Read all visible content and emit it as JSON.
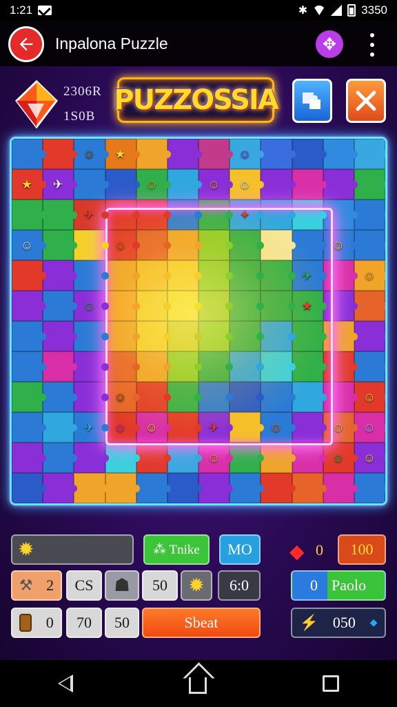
{
  "status_bar": {
    "time": "1:21",
    "battery_text": "3350",
    "icons": [
      "mail-icon",
      "bluetooth-icon",
      "wifi-icon",
      "signal-icon",
      "battery-icon"
    ]
  },
  "app_bar": {
    "title": "Inpalona Puzzle",
    "back_icon": "back-arrow-icon",
    "gamepad_icon": "gamepad-icon",
    "menu_icon": "more-vert-icon"
  },
  "game_header": {
    "stat_1": "2306R",
    "stat_2": "1S0B",
    "logo_text": "PUZZOSSIA",
    "blue_button_icon": "puzzle-piece-icon",
    "orange_button_icon": "close-icon"
  },
  "board": {
    "rows": 12,
    "cols": 12,
    "highlight_region": "center",
    "colors": [
      [
        "#2b7bd6",
        "#e23a2a",
        "#2b7bd6",
        "#e67a1a",
        "#f0a52a",
        "#8a2fd8",
        "#c23a8a",
        "#3aa8e0",
        "#3a6ee0",
        "#2b5bc8",
        "#2f8ae0",
        "#3aa8e0"
      ],
      [
        "#e23a2a",
        "#8a2fd8",
        "#2b7bd6",
        "#2b5bc8",
        "#2fb04a",
        "#2fa8e0",
        "#8a2fd8",
        "#f5c02a",
        "#8a2fd8",
        "#d82fa8",
        "#8a2fd8",
        "#2fb04a"
      ],
      [
        "#2fb04a",
        "#2fb04a",
        "#d83a2a",
        "#e23a2a",
        "#e23a2a",
        "#2b7bd6",
        "#2fb04a",
        "#2fa8e0",
        "#2fa8e0",
        "#3ad0e0",
        "#2f8ae0",
        "#2b7bd6"
      ],
      [
        "#2b7bd6",
        "#2fb04a",
        "#f5d02a",
        "#e23a2a",
        "#e6642a",
        "#f0a52a",
        "#8ad02a",
        "#2fb04a",
        "#f5e89a",
        "#2b7bd6",
        "#2b7bd6",
        "#2b7bd6"
      ],
      [
        "#e23a2a",
        "#8a2fd8",
        "#2b7bd6",
        "#f0a52a",
        "#f5c02a",
        "#f5d02a",
        "#8ad02a",
        "#2fb04a",
        "#2fb04a",
        "#2b7bd6",
        "#d82fa8",
        "#f0a52a"
      ],
      [
        "#8a2fd8",
        "#2b7bd6",
        "#8a2fd8",
        "#f5a52a",
        "#f5d02a",
        "#f5e02a",
        "#9ad02a",
        "#2fb04a",
        "#2fb04a",
        "#2fb04a",
        "#8a2fd8",
        "#e6642a"
      ],
      [
        "#2b7bd6",
        "#8a2fd8",
        "#2b7bd6",
        "#f0a52a",
        "#f5d02a",
        "#d0d02a",
        "#8ad02a",
        "#2fb04a",
        "#2fa8e0",
        "#2fb04a",
        "#f0a52a",
        "#8a2fd8"
      ],
      [
        "#2b7bd6",
        "#d82fa8",
        "#8a2fd8",
        "#e6642a",
        "#f0a52a",
        "#8ad02a",
        "#2fb04a",
        "#2fa8e0",
        "#3ad0e0",
        "#2fb04a",
        "#e23a2a",
        "#2b7bd6"
      ],
      [
        "#2fb04a",
        "#2b7bd6",
        "#8a2fd8",
        "#e6642a",
        "#e23a2a",
        "#2fb04a",
        "#2b7bd6",
        "#2b5bc8",
        "#2b7bd6",
        "#2fa8e0",
        "#d82fa8",
        "#e23a2a"
      ],
      [
        "#2b7bd6",
        "#2fa8e0",
        "#2b7bd6",
        "#e23a2a",
        "#d82fa8",
        "#e23a2a",
        "#8a2fd8",
        "#f5c02a",
        "#2b7bd6",
        "#8a2fd8",
        "#e6642a",
        "#d82fa8"
      ],
      [
        "#8a2fd8",
        "#2b7bd6",
        "#8a2fd8",
        "#3ad0e0",
        "#e23a2a",
        "#3aa8e0",
        "#d82fa8",
        "#2fb04a",
        "#f0a52a",
        "#d82fa8",
        "#e23a2a",
        "#8a2fd8"
      ],
      [
        "#2b5bc8",
        "#8a2fd8",
        "#f0a52a",
        "#f0a52a",
        "#2b7bd6",
        "#2b5bc8",
        "#8a2fd8",
        "#2b7bd6",
        "#e23a2a",
        "#e6642a",
        "#d82fa8",
        "#2b7bd6"
      ]
    ],
    "sprites": [
      {
        "row": 0,
        "col": 2,
        "glyph": "☺",
        "color": "#8a5a2a"
      },
      {
        "row": 0,
        "col": 3,
        "glyph": "★",
        "color": "#ffd42a"
      },
      {
        "row": 0,
        "col": 7,
        "glyph": "☺",
        "color": "#7a3ae0"
      },
      {
        "row": 1,
        "col": 0,
        "glyph": "★",
        "color": "#ffd42a"
      },
      {
        "row": 1,
        "col": 1,
        "glyph": "✈",
        "color": "#ffffff"
      },
      {
        "row": 1,
        "col": 4,
        "glyph": "☺",
        "color": "#f5a52a"
      },
      {
        "row": 1,
        "col": 6,
        "glyph": "☺",
        "color": "#f5a52a"
      },
      {
        "row": 1,
        "col": 7,
        "glyph": "☺",
        "color": "#f5f5f5"
      },
      {
        "row": 2,
        "col": 2,
        "glyph": "✈",
        "color": "#e23a2a"
      },
      {
        "row": 2,
        "col": 7,
        "glyph": "✦",
        "color": "#e23a2a"
      },
      {
        "row": 3,
        "col": 0,
        "glyph": "☺",
        "color": "#d0e0f0"
      },
      {
        "row": 3,
        "col": 3,
        "glyph": "☺",
        "color": "#e6642a"
      },
      {
        "row": 3,
        "col": 10,
        "glyph": "☺",
        "color": "#f5d02a"
      },
      {
        "row": 4,
        "col": 9,
        "glyph": "✈",
        "color": "#2fb04a"
      },
      {
        "row": 4,
        "col": 11,
        "glyph": "☺",
        "color": "#f5a52a"
      },
      {
        "row": 5,
        "col": 2,
        "glyph": "☺",
        "color": "#2fb04a"
      },
      {
        "row": 5,
        "col": 9,
        "glyph": "★",
        "color": "#e23a2a"
      },
      {
        "row": 8,
        "col": 3,
        "glyph": "☺",
        "color": "#8a5a2a"
      },
      {
        "row": 8,
        "col": 11,
        "glyph": "☺",
        "color": "#f5d02a"
      },
      {
        "row": 9,
        "col": 2,
        "glyph": "✈",
        "color": "#2fa8e0"
      },
      {
        "row": 9,
        "col": 3,
        "glyph": "☺",
        "color": "#d82fa8"
      },
      {
        "row": 9,
        "col": 4,
        "glyph": "☺",
        "color": "#f5d02a"
      },
      {
        "row": 9,
        "col": 6,
        "glyph": "✈",
        "color": "#e23a2a"
      },
      {
        "row": 9,
        "col": 8,
        "glyph": "☺",
        "color": "#e6642a"
      },
      {
        "row": 9,
        "col": 10,
        "glyph": "☺",
        "color": "#f5d02a"
      },
      {
        "row": 9,
        "col": 11,
        "glyph": "☺",
        "color": "#b0b0f0"
      },
      {
        "row": 10,
        "col": 6,
        "glyph": "☺",
        "color": "#f5a52a"
      },
      {
        "row": 10,
        "col": 10,
        "glyph": "☺",
        "color": "#2fb04a"
      },
      {
        "row": 10,
        "col": 11,
        "glyph": "☺",
        "color": "#f5d02a"
      }
    ]
  },
  "hud": {
    "sun_bar_icon": "sun-icon",
    "tnike_label": "⁂ Tnike",
    "mo_label": "MO",
    "gem_count": "0",
    "coins_label": "100",
    "items": [
      {
        "icon": "hammer-icon",
        "value": "2"
      },
      {
        "value": "CS"
      },
      {
        "icon": "robot-icon"
      },
      {
        "value": "50"
      },
      {
        "icon": "sun-icon"
      },
      {
        "value": "6:0"
      },
      {
        "icon": "barrel-icon",
        "value": "0"
      },
      {
        "value": "70"
      },
      {
        "value": "50"
      }
    ],
    "start_label": "Sbeat",
    "paolo_count": "0",
    "paolo_label": "Paolo",
    "energy_value": "050"
  }
}
